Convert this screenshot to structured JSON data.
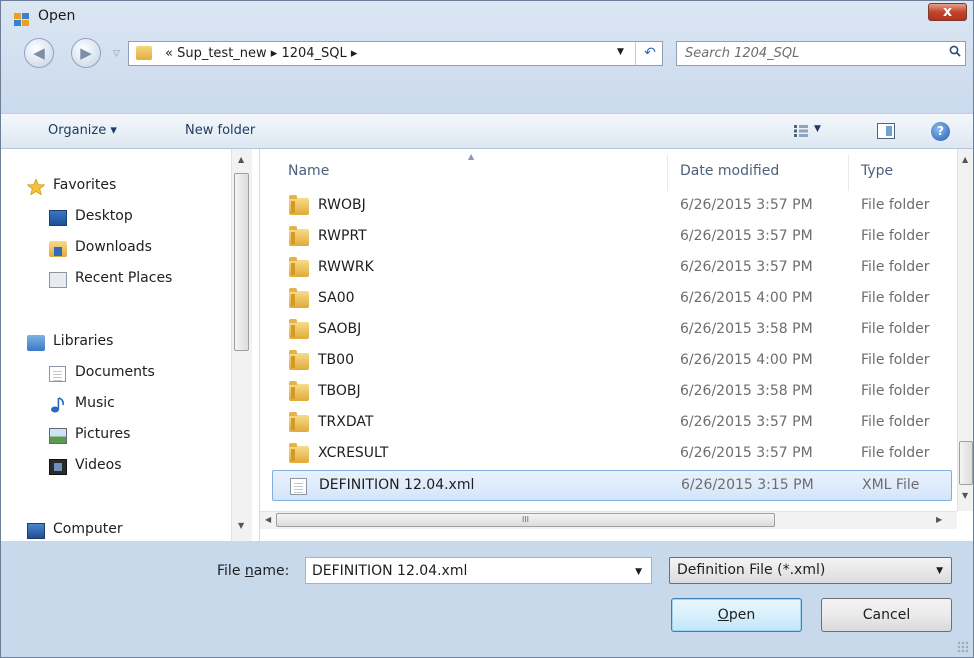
{
  "window": {
    "title": "Open",
    "close_label": "x"
  },
  "navigation": {
    "back_glyph": "◀",
    "forward_glyph": "▶",
    "address_path": "« Sup_test_new ▸ 1204_SQL ▸",
    "refresh_glyph": "↶",
    "search_placeholder": "Search 1204_SQL"
  },
  "toolbar": {
    "organize_label": "Organize ▾",
    "new_folder_label": "New folder",
    "help_glyph": "?"
  },
  "sidebar": {
    "favorites": {
      "label": "Favorites",
      "items": [
        "Desktop",
        "Downloads",
        "Recent Places"
      ]
    },
    "libraries": {
      "label": "Libraries",
      "items": [
        "Documents",
        "Music",
        "Pictures",
        "Videos"
      ]
    },
    "computer_label": "Computer"
  },
  "file_list": {
    "columns": [
      "Name",
      "Date modified",
      "Type"
    ],
    "rows": [
      {
        "name": "RWOBJ",
        "date": "6/26/2015 3:57 PM",
        "type": "File folder",
        "kind": "folder"
      },
      {
        "name": "RWPRT",
        "date": "6/26/2015 3:57 PM",
        "type": "File folder",
        "kind": "folder"
      },
      {
        "name": "RWWRK",
        "date": "6/26/2015 3:57 PM",
        "type": "File folder",
        "kind": "folder"
      },
      {
        "name": "SA00",
        "date": "6/26/2015 4:00 PM",
        "type": "File folder",
        "kind": "folder"
      },
      {
        "name": "SAOBJ",
        "date": "6/26/2015 3:58 PM",
        "type": "File folder",
        "kind": "folder"
      },
      {
        "name": "TB00",
        "date": "6/26/2015 4:00 PM",
        "type": "File folder",
        "kind": "folder"
      },
      {
        "name": "TBOBJ",
        "date": "6/26/2015 3:58 PM",
        "type": "File folder",
        "kind": "folder"
      },
      {
        "name": "TRXDAT",
        "date": "6/26/2015 3:57 PM",
        "type": "File folder",
        "kind": "folder"
      },
      {
        "name": "XCRESULT",
        "date": "6/26/2015 3:57 PM",
        "type": "File folder",
        "kind": "folder"
      },
      {
        "name": "DEFINITION 12.04.xml",
        "date": "6/26/2015 3:15 PM",
        "type": "XML File",
        "kind": "file",
        "selected": true
      }
    ]
  },
  "footer": {
    "file_name_label_pre": "File ",
    "file_name_label_accel": "n",
    "file_name_label_post": "ame:",
    "file_name_value": "DEFINITION 12.04.xml",
    "filter_value": "Definition File (*.xml)",
    "open_accel": "O",
    "open_rest": "pen",
    "cancel_label": "Cancel"
  },
  "colors": {
    "selection": "#d4e5fa",
    "selection_border": "#82aee3",
    "close_button": "#c2452b"
  }
}
